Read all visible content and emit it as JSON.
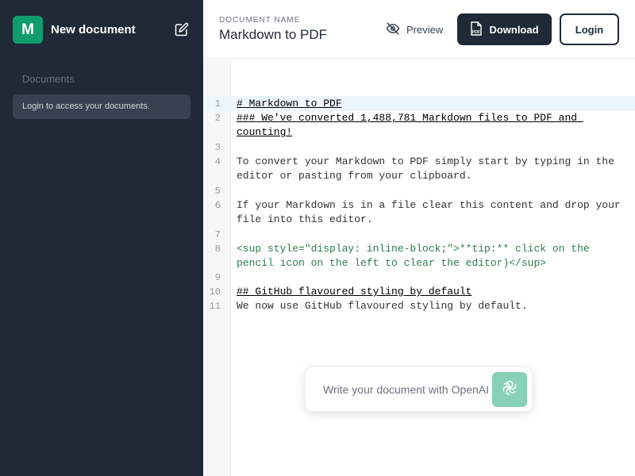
{
  "sidebar": {
    "logo_letter": "M",
    "new_document": "New document",
    "section_title": "Documents",
    "login_prompt": "Login to access your documents."
  },
  "header": {
    "doc_label": "DOCUMENT NAME",
    "doc_name": "Markdown to PDF",
    "preview_label": "Preview",
    "download_label": "Download",
    "login_label": "Login"
  },
  "editor": {
    "lines": [
      {
        "n": "1",
        "text": "# Markdown to PDF"
      },
      {
        "n": "2",
        "text": "### We've converted 1,488,781 Markdown files to PDF and counting!"
      },
      {
        "n": "3",
        "text": ""
      },
      {
        "n": "4",
        "text": "To convert your Markdown to PDF simply start by typing in the editor or pasting from your clipboard."
      },
      {
        "n": "5",
        "text": ""
      },
      {
        "n": "6",
        "text": "If your Markdown is in a file clear this content and drop your file into this editor."
      },
      {
        "n": "7",
        "text": ""
      },
      {
        "n": "8",
        "text": "<sup style=\"display: inline-block;\">**tip:** click on the pencil icon on the left to clear the editor)</sup>"
      },
      {
        "n": "9",
        "text": ""
      },
      {
        "n": "10",
        "text": "## GitHub flavoured styling by default"
      },
      {
        "n": "11",
        "text": "We now use GitHub flavoured styling by default."
      }
    ]
  },
  "ai_prompt": {
    "placeholder": "Write your document with OpenAI"
  },
  "colors": {
    "sidebar_bg": "#1f2937",
    "accent": "#0f9d6b",
    "send_button": "#87d1b5"
  }
}
